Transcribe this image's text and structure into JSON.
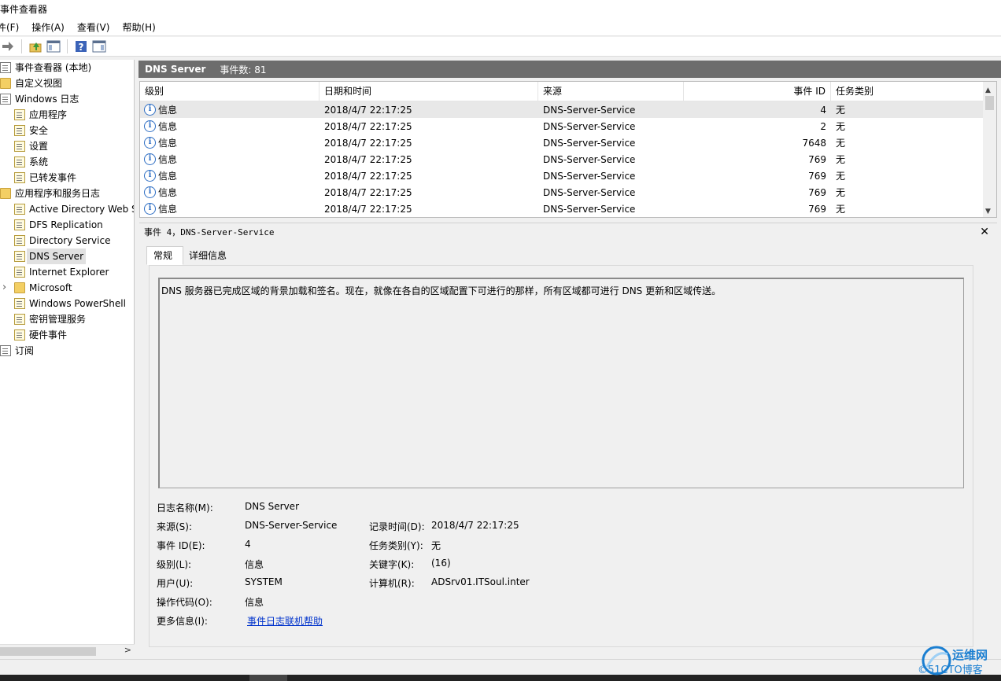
{
  "window": {
    "title": "事件查看器"
  },
  "menu": [
    "件(F)",
    "操作(A)",
    "查看(V)",
    "帮助(H)"
  ],
  "toolbar": {
    "buttons": [
      "forward-arrow-icon",
      "up-folder-icon",
      "show-hide-tree-icon",
      "help-icon",
      "show-hide-action-pane-icon"
    ]
  },
  "tree": {
    "items": [
      {
        "label": "事件查看器 (本地)",
        "indent": 0,
        "icon": "event-viewer-icon"
      },
      {
        "label": "自定义视图",
        "indent": 0,
        "icon": "folder-icon"
      },
      {
        "label": "Windows 日志",
        "indent": 0,
        "icon": "windows-logs-icon"
      },
      {
        "label": "应用程序",
        "indent": 1,
        "icon": "log-icon"
      },
      {
        "label": "安全",
        "indent": 1,
        "icon": "log-icon"
      },
      {
        "label": "设置",
        "indent": 1,
        "icon": "log-icon"
      },
      {
        "label": "系统",
        "indent": 1,
        "icon": "log-icon"
      },
      {
        "label": "已转发事件",
        "indent": 1,
        "icon": "log-icon"
      },
      {
        "label": "应用程序和服务日志",
        "indent": 0,
        "icon": "folder-icon"
      },
      {
        "label": "Active Directory Web S",
        "indent": 1,
        "icon": "log-icon"
      },
      {
        "label": "DFS Replication",
        "indent": 1,
        "icon": "log-icon"
      },
      {
        "label": "Directory Service",
        "indent": 1,
        "icon": "log-icon"
      },
      {
        "label": "DNS Server",
        "indent": 1,
        "icon": "log-icon",
        "selected": true
      },
      {
        "label": "Internet Explorer",
        "indent": 1,
        "icon": "log-icon"
      },
      {
        "label": "Microsoft",
        "indent": 1,
        "icon": "folder-icon",
        "expandable": true
      },
      {
        "label": "Windows PowerShell",
        "indent": 1,
        "icon": "log-icon"
      },
      {
        "label": "密钥管理服务",
        "indent": 1,
        "icon": "log-icon"
      },
      {
        "label": "硬件事件",
        "indent": 1,
        "icon": "log-icon"
      },
      {
        "label": "订阅",
        "indent": 0,
        "icon": "subscriptions-icon"
      }
    ]
  },
  "panel": {
    "title": "DNS Server",
    "count": "事件数: 81"
  },
  "grid": {
    "columns": [
      "级别",
      "日期和时间",
      "来源",
      "事件 ID",
      "任务类别"
    ],
    "rows": [
      {
        "level": "信息",
        "datetime": "2018/4/7 22:17:25",
        "source": "DNS-Server-Service",
        "id": "4",
        "category": "无"
      },
      {
        "level": "信息",
        "datetime": "2018/4/7 22:17:25",
        "source": "DNS-Server-Service",
        "id": "2",
        "category": "无"
      },
      {
        "level": "信息",
        "datetime": "2018/4/7 22:17:25",
        "source": "DNS-Server-Service",
        "id": "7648",
        "category": "无"
      },
      {
        "level": "信息",
        "datetime": "2018/4/7 22:17:25",
        "source": "DNS-Server-Service",
        "id": "769",
        "category": "无"
      },
      {
        "level": "信息",
        "datetime": "2018/4/7 22:17:25",
        "source": "DNS-Server-Service",
        "id": "769",
        "category": "无"
      },
      {
        "level": "信息",
        "datetime": "2018/4/7 22:17:25",
        "source": "DNS-Server-Service",
        "id": "769",
        "category": "无"
      },
      {
        "level": "信息",
        "datetime": "2018/4/7 22:17:25",
        "source": "DNS-Server-Service",
        "id": "769",
        "category": "无"
      }
    ]
  },
  "detail": {
    "header": "事件 4，DNS-Server-Service",
    "tabs": [
      "常规",
      "详细信息"
    ],
    "description": "DNS 服务器已完成区域的背景加载和签名。现在，就像在各自的区域配置下可进行的那样，所有区域都可进行 DNS 更新和区域传送。",
    "labels": {
      "log_name": "日志名称(M):",
      "source": "来源(S):",
      "event_id": "事件 ID(E):",
      "level": "级别(L):",
      "user": "用户(U):",
      "opcode": "操作代码(O):",
      "more_info": "更多信息(I):",
      "logged": "记录时间(D):",
      "task_category": "任务类别(Y):",
      "keywords": "关键字(K):",
      "computer": "计算机(R):"
    },
    "values": {
      "log_name": "DNS Server",
      "source": "DNS-Server-Service",
      "event_id": "4",
      "level": "信息",
      "user": "SYSTEM",
      "opcode": "信息",
      "more_info": "事件日志联机帮助",
      "logged": "2018/4/7 22:17:25",
      "task_category": "无",
      "keywords": "(16)",
      "computer": "ADSrv01.ITSoul.inter"
    }
  },
  "watermark": {
    "line1": "运维网",
    "line2": "©51CTO博客"
  }
}
